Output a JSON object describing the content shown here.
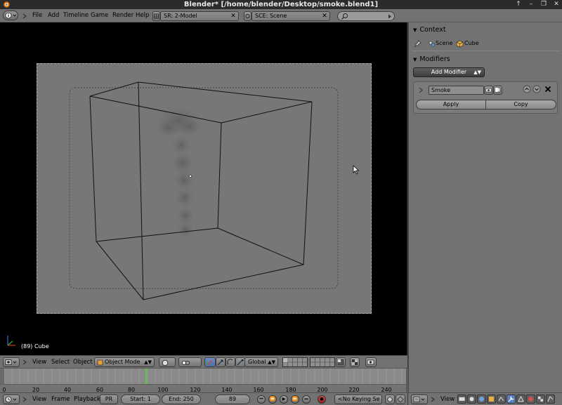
{
  "window": {
    "title": "Blender* [/home/blender/Desktop/smoke.blend1]",
    "controls": [
      "↑",
      "–",
      "❐",
      "✕"
    ]
  },
  "info_header": {
    "menus": [
      "File",
      "Add",
      "Timeline",
      "Game",
      "Render",
      "Help"
    ],
    "screen_field": "SR: 2-Model",
    "scene_field": "SCE: Scene",
    "search_placeholder": ""
  },
  "viewport": {
    "object_label": "(89) Cube"
  },
  "view3d_header": {
    "menus": [
      "View",
      "Select",
      "Object"
    ],
    "mode": "Object Mode",
    "orientation": "Global"
  },
  "timeline": {
    "ticks": [
      "0",
      "20",
      "40",
      "60",
      "80",
      "100",
      "120",
      "140",
      "160",
      "180",
      "200",
      "220",
      "240"
    ],
    "current_frame_marker": 89
  },
  "timeline_header": {
    "menus": [
      "View",
      "Frame",
      "Playback"
    ],
    "pr_label": "PR",
    "start": "Start: 1",
    "end": "End: 250",
    "current_frame": "89",
    "keying_set": "<No Keying Se"
  },
  "properties": {
    "context_title": "Context",
    "context_scene": "Scene",
    "context_cube": "Cube",
    "modifiers_title": "Modifiers",
    "add_modifier": "Add Modifier",
    "modifier_name": "Smoke",
    "apply": "Apply",
    "copy": "Copy",
    "header_view": "View"
  },
  "colors": {
    "header_bg": "#727272",
    "active_tab": "#5a7fbf"
  }
}
